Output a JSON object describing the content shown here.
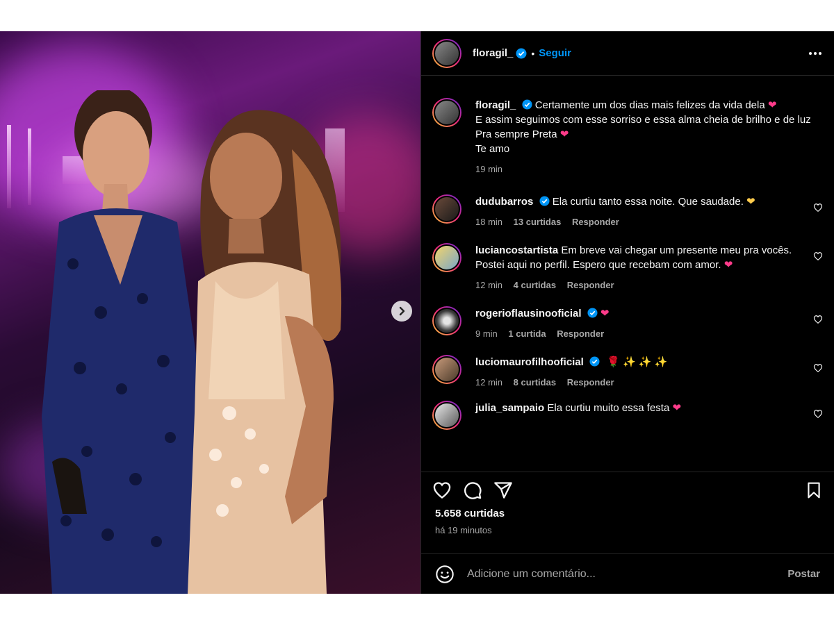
{
  "post": {
    "author": "floragil_",
    "follow_label": "Seguir",
    "separator": "•",
    "caption": {
      "username": "floragil_",
      "lines": [
        "Certamente um dos dias mais felizes da vida dela",
        "E assim seguimos com esse sorriso e essa alma cheia de brilho e de luz",
        "Pra sempre Preta",
        "Te amo"
      ],
      "time": "19 min"
    },
    "comments": [
      {
        "username": "dudubarros",
        "verified": true,
        "text": "Ela curtiu tanto essa noite. Que saudade.",
        "emoji": "yellow-heart",
        "time": "18 min",
        "likes": "13 curtidas",
        "reply": "Responder"
      },
      {
        "username": "luciancostartista",
        "verified": false,
        "text": "Em breve vai chegar um presente meu pra vocês. Postei aqui no perfil. Espero que recebam com amor.",
        "emoji": "pink-heart",
        "time": "12 min",
        "likes": "4 curtidas",
        "reply": "Responder"
      },
      {
        "username": "rogerioflausinooficial",
        "verified": true,
        "text": "",
        "emoji": "pink-heart",
        "time": "9 min",
        "likes": "1 curtida",
        "reply": "Responder"
      },
      {
        "username": "luciomaurofilhooficial",
        "verified": true,
        "text": "🌹 ✨ ✨ ✨",
        "emoji": "",
        "time": "12 min",
        "likes": "8 curtidas",
        "reply": "Responder"
      },
      {
        "username": "julia_sampaio",
        "verified": false,
        "text": "Ela curtiu muito essa festa",
        "emoji": "pink-heart",
        "time": "",
        "likes": "",
        "reply": ""
      }
    ],
    "likes_count": "5.658 curtidas",
    "posted_ago": "há 19 minutos",
    "composer": {
      "placeholder": "Adicione um comentário...",
      "post_label": "Postar"
    },
    "icons": {
      "like": "heart-icon",
      "comment": "comment-icon",
      "share": "send-icon",
      "save": "bookmark-icon",
      "more": "more-icon",
      "emoji": "emoji-icon",
      "next": "chevron-right-icon"
    },
    "colors": {
      "verified": "#0095f6",
      "follow": "#0095f6",
      "heart": "#ff3040"
    }
  }
}
